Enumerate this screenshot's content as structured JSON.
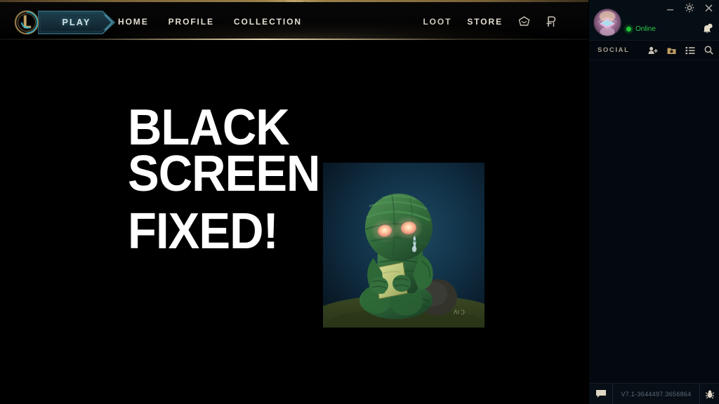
{
  "window": {
    "minimize_icon": "minimize-icon",
    "settings_icon": "gear-icon",
    "close_icon": "close-icon"
  },
  "nav": {
    "logo_icon": "league-logo-icon",
    "play_label": "PLAY",
    "links": [
      {
        "label": "HOME",
        "name": "nav-link-home"
      },
      {
        "label": "PROFILE",
        "name": "nav-link-profile"
      },
      {
        "label": "COLLECTION",
        "name": "nav-link-collection"
      }
    ],
    "right_links": [
      {
        "label": "LOOT",
        "name": "nav-link-loot"
      },
      {
        "label": "STORE",
        "name": "nav-link-store"
      }
    ],
    "chest_icon": "hextech-chest-icon",
    "currency_icon": "riot-points-icon",
    "chevron_icon": "chevron-down-ornament-icon"
  },
  "main": {
    "headline_line1": "BLACK SCREEN",
    "headline_line2": "FIXED!",
    "artwork_name": "amumu-summoner-icon-art",
    "artwork_colors": {
      "background_top": "#143044",
      "background_mid": "#0d2233",
      "grass": "#4a5a2a",
      "body": "#2f6b3a",
      "eye_glow": "#ffb9a0"
    }
  },
  "social": {
    "avatar_name": "summoner-avatar",
    "status_text": "Online",
    "status_color": "#2ecb49",
    "notification_icon": "bell-icon",
    "title": "SOCIAL",
    "actions": [
      {
        "name": "add-friend-icon"
      },
      {
        "name": "inbox-folder-icon"
      },
      {
        "name": "friend-list-icon"
      },
      {
        "name": "search-icon"
      }
    ],
    "footer": {
      "chat_icon": "chat-icon",
      "version": "V7.1-3644497.3656864",
      "bug_icon": "bug-report-icon"
    }
  },
  "colors": {
    "gold": "#c0a468",
    "panel_bg": "#03090f",
    "nav_text": "#e3ded2",
    "play_text": "#cfe3e8"
  }
}
